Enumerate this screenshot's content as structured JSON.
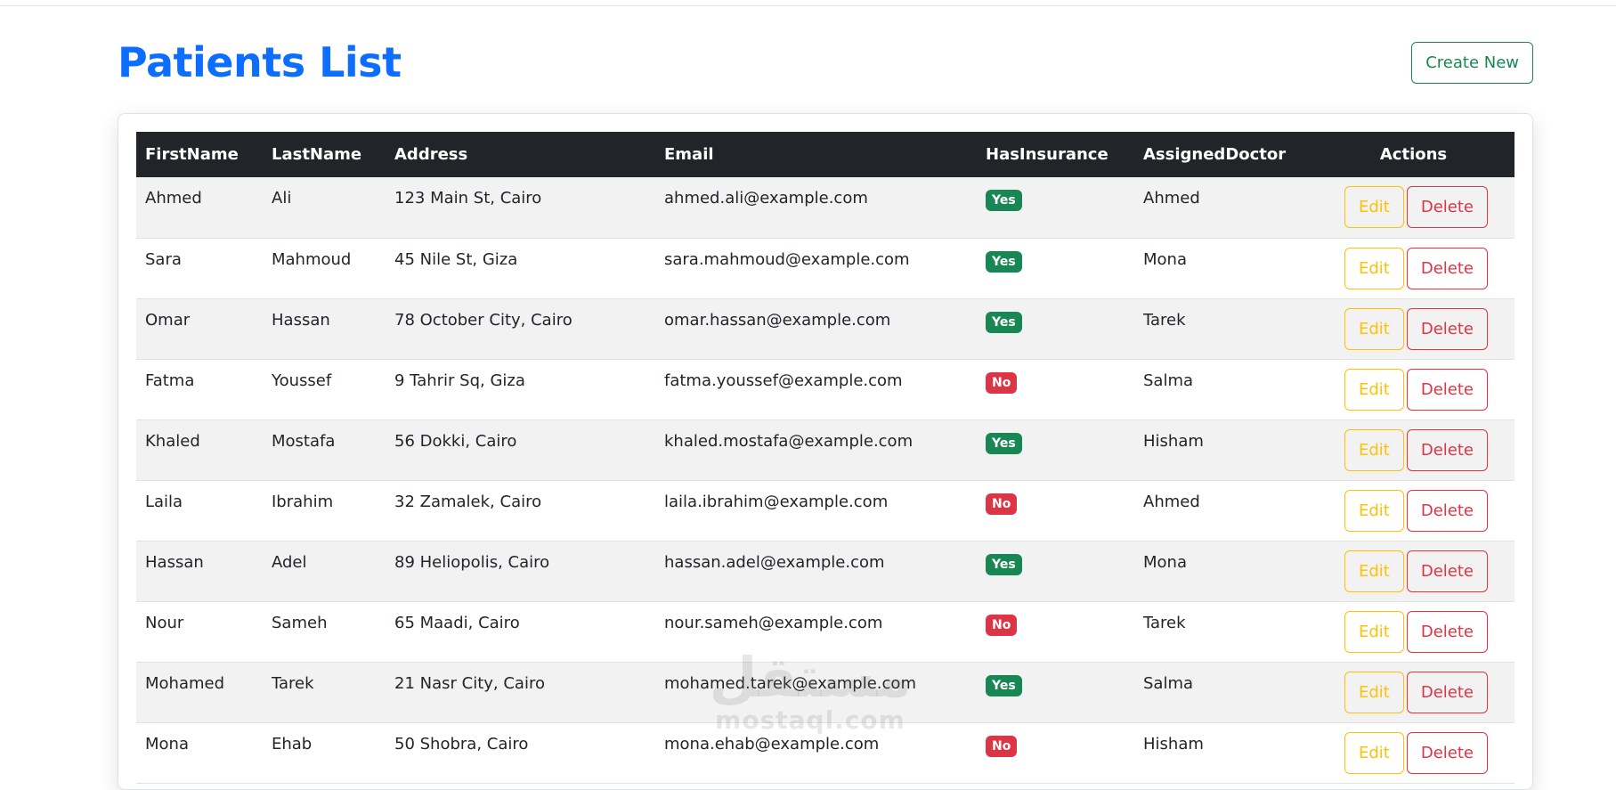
{
  "page": {
    "title": "Patients List",
    "create_button": "Create New"
  },
  "table": {
    "columns": [
      "FirstName",
      "LastName",
      "Address",
      "Email",
      "HasInsurance",
      "AssignedDoctor",
      "Actions"
    ],
    "rows": [
      {
        "first": "Ahmed",
        "last": "Ali",
        "address": "123 Main St, Cairo",
        "email": "ahmed.ali@example.com",
        "insurance": "Yes",
        "doctor": "Ahmed"
      },
      {
        "first": "Sara",
        "last": "Mahmoud",
        "address": "45 Nile St, Giza",
        "email": "sara.mahmoud@example.com",
        "insurance": "Yes",
        "doctor": "Mona"
      },
      {
        "first": "Omar",
        "last": "Hassan",
        "address": "78 October City, Cairo",
        "email": "omar.hassan@example.com",
        "insurance": "Yes",
        "doctor": "Tarek"
      },
      {
        "first": "Fatma",
        "last": "Youssef",
        "address": "9 Tahrir Sq, Giza",
        "email": "fatma.youssef@example.com",
        "insurance": "No",
        "doctor": "Salma"
      },
      {
        "first": "Khaled",
        "last": "Mostafa",
        "address": "56 Dokki, Cairo",
        "email": "khaled.mostafa@example.com",
        "insurance": "Yes",
        "doctor": "Hisham"
      },
      {
        "first": "Laila",
        "last": "Ibrahim",
        "address": "32 Zamalek, Cairo",
        "email": "laila.ibrahim@example.com",
        "insurance": "No",
        "doctor": "Ahmed"
      },
      {
        "first": "Hassan",
        "last": "Adel",
        "address": "89 Heliopolis, Cairo",
        "email": "hassan.adel@example.com",
        "insurance": "Yes",
        "doctor": "Mona"
      },
      {
        "first": "Nour",
        "last": "Sameh",
        "address": "65 Maadi, Cairo",
        "email": "nour.sameh@example.com",
        "insurance": "No",
        "doctor": "Tarek"
      },
      {
        "first": "Mohamed",
        "last": "Tarek",
        "address": "21 Nasr City, Cairo",
        "email": "mohamed.tarek@example.com",
        "insurance": "Yes",
        "doctor": "Salma"
      },
      {
        "first": "Mona",
        "last": "Ehab",
        "address": "50 Shobra, Cairo",
        "email": "mona.ehab@example.com",
        "insurance": "No",
        "doctor": "Hisham"
      }
    ],
    "edit_label": "Edit",
    "delete_label": "Delete"
  },
  "watermark": {
    "arabic": "مستقل",
    "latin": "mostaql.com"
  },
  "colors": {
    "primary": "#0d6efd",
    "success": "#198754",
    "danger": "#dc3545",
    "warning": "#ffc107",
    "header_bg": "#212529"
  }
}
